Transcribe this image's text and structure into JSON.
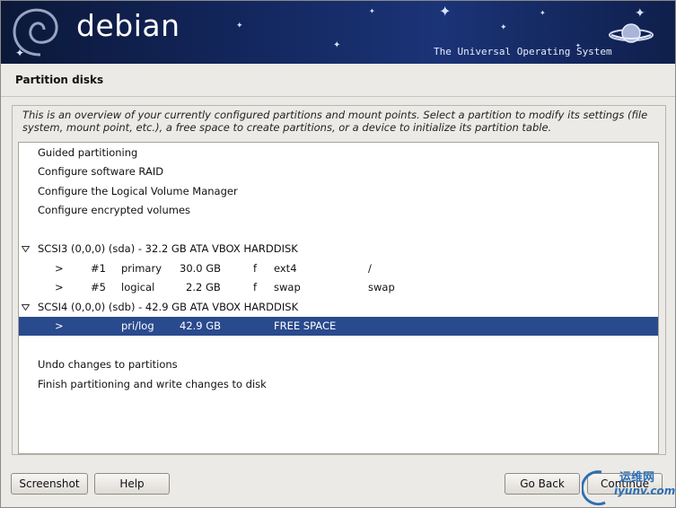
{
  "banner": {
    "logo_text": "debian",
    "tagline": "The Universal Operating System"
  },
  "page": {
    "title": "Partition disks",
    "description": "This is an overview of your currently configured partitions and mount points. Select a partition to modify its settings (file system, mount point, etc.), a free space to create partitions, or a device to initialize its partition table."
  },
  "list": {
    "actions": [
      "Guided partitioning",
      "Configure software RAID",
      "Configure the Logical Volume Manager",
      "Configure encrypted volumes"
    ],
    "disk1": {
      "label": "SCSI3 (0,0,0) (sda) - 32.2 GB ATA VBOX HARDDISK",
      "partitions": [
        {
          "arrow": ">",
          "num": "#1",
          "type": "primary",
          "size": "30.0 GB",
          "flag": "f",
          "fs": "ext4",
          "mount": "/"
        },
        {
          "arrow": ">",
          "num": "#5",
          "type": "logical",
          "size": "2.2 GB",
          "flag": "f",
          "fs": "swap",
          "mount": "swap"
        }
      ]
    },
    "disk2": {
      "label": "SCSI4 (0,0,0) (sdb) - 42.9 GB ATA VBOX HARDDISK",
      "free": {
        "arrow": ">",
        "type": "pri/log",
        "size": "42.9 GB",
        "fs": "FREE SPACE"
      }
    },
    "bottom_actions": [
      "Undo changes to partitions",
      "Finish partitioning and write changes to disk"
    ]
  },
  "buttons": {
    "screenshot": "Screenshot",
    "help": "Help",
    "go_back": "Go Back",
    "continue": "Continue"
  },
  "watermark": {
    "line1": "运维网",
    "line2": "iyunv.com"
  },
  "colors": {
    "selection": "#2a4a8e",
    "banner": "#13265c",
    "watermark": "#2d6fb3"
  }
}
